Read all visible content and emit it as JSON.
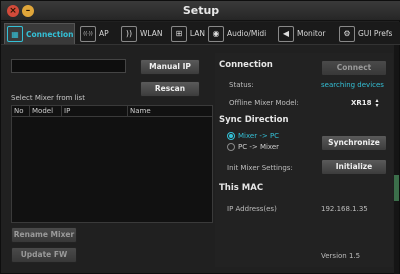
{
  "window": {
    "title": "Setup",
    "close_glyph": "×",
    "min_glyph": "–"
  },
  "tabs": [
    {
      "label": "Connection",
      "icon": "connection-icon",
      "glyph": "▦",
      "active": true
    },
    {
      "label": "AP",
      "icon": "ap-icon",
      "glyph": "((·))",
      "active": false
    },
    {
      "label": "WLAN",
      "icon": "wifi-icon",
      "glyph": "))",
      "active": false
    },
    {
      "label": "LAN",
      "icon": "lan-icon",
      "glyph": "⊞",
      "active": false
    },
    {
      "label": "Audio/Midi",
      "icon": "audio-midi-icon",
      "glyph": "◉",
      "active": false
    },
    {
      "label": "Monitor",
      "icon": "monitor-speaker-icon",
      "glyph": "◀",
      "active": false
    },
    {
      "label": "GUI Prefs",
      "icon": "gui-prefs-icon",
      "glyph": "⚙",
      "active": false
    }
  ],
  "left": {
    "manual_ip_label": "Manual IP",
    "rescan_label": "Rescan",
    "select_label": "Select Mixer from list",
    "columns": [
      "No",
      "Model",
      "IP",
      "Name"
    ],
    "rename_label": "Rename Mixer",
    "update_fw_label": "Update FW"
  },
  "right": {
    "connection_heading": "Connection",
    "connect_label": "Connect",
    "status_label": "Status:",
    "status_value": "searching devices",
    "offline_model_label": "Offline Mixer Model:",
    "offline_model_value": "XR18",
    "sync_heading": "Sync Direction",
    "sync_options": [
      "Mixer -> PC",
      "PC -> Mixer"
    ],
    "synchronize_label": "Synchronize",
    "init_label": "Init Mixer Settings:",
    "initialize_label": "Initialize",
    "mac_heading": "This MAC",
    "ip_label": "IP Address(es)",
    "ip_value": "192.168.1.35",
    "version": "Version 1.5"
  },
  "colors": {
    "accent": "#34c0d6",
    "background": "#202020",
    "button": "#4a4a4a"
  }
}
